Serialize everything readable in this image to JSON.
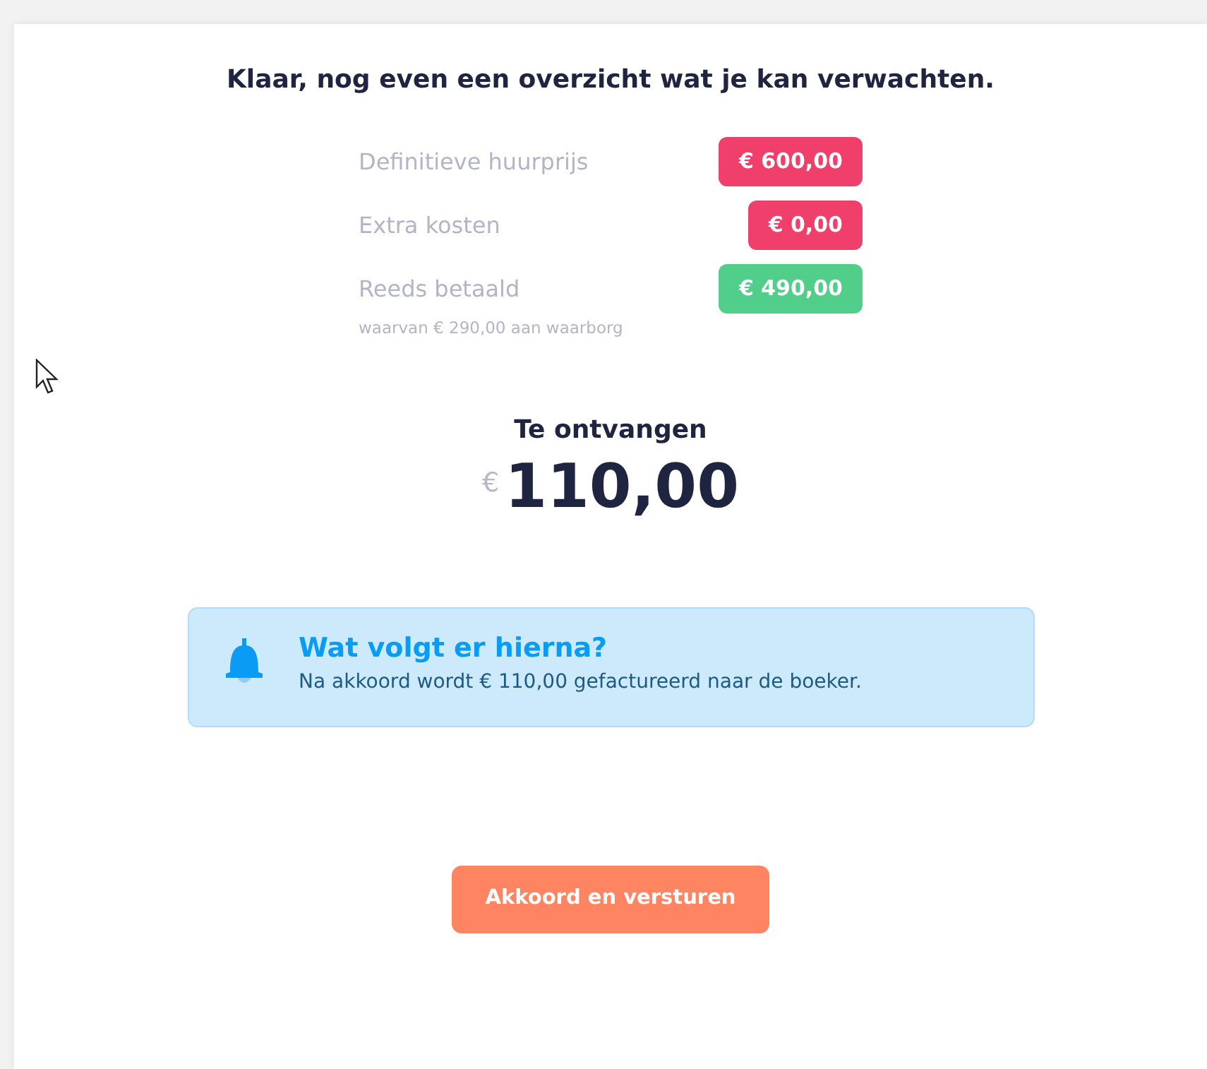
{
  "title": "Klaar, nog even een overzicht wat je kan verwachten.",
  "lines": [
    {
      "label": "Definitieve huurprijs",
      "amount": "€ 600,00",
      "color": "#f13f6c"
    },
    {
      "label": "Extra kosten",
      "amount": "€ 0,00",
      "color": "#f13f6c"
    },
    {
      "label": "Reeds betaald",
      "amount": "€ 490,00",
      "color": "#51cf8a"
    }
  ],
  "note": "waarvan € 290,00 aan waarborg",
  "total": {
    "label": "Te ontvangen",
    "currency": "€",
    "amount": "110,00"
  },
  "info": {
    "title": "Wat volgt er hierna?",
    "text": "Na akkoord wordt € 110,00 gefactureerd naar de boeker."
  },
  "button": "Akkoord en versturen"
}
